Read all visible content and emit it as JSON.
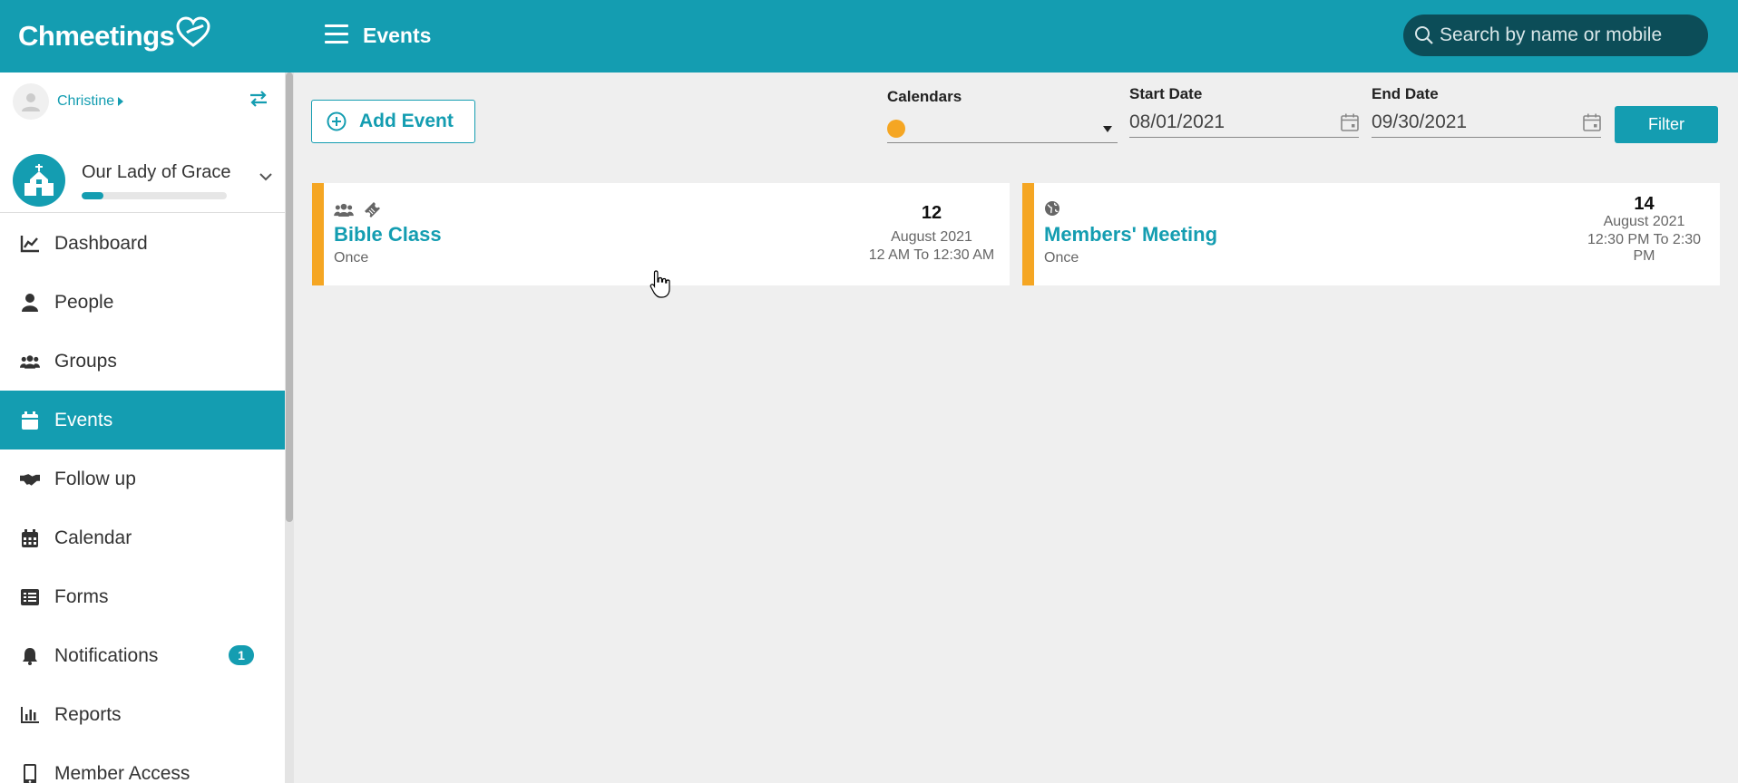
{
  "app": {
    "logo_text": "Chmeetings",
    "page_title": "Events",
    "search_placeholder": "Search by name or mobile",
    "brand_color": "#149db1"
  },
  "sidebar": {
    "user_name": "Christine",
    "org_name": "Our Lady of Grace",
    "org_progress": 0.15,
    "items": [
      {
        "label": "Dashboard",
        "icon": "chart-line-icon",
        "active": false
      },
      {
        "label": "People",
        "icon": "user-icon",
        "active": false
      },
      {
        "label": "Groups",
        "icon": "users-icon",
        "active": false
      },
      {
        "label": "Events",
        "icon": "calendar-icon",
        "active": true
      },
      {
        "label": "Follow up",
        "icon": "handshake-icon",
        "active": false
      },
      {
        "label": "Calendar",
        "icon": "calendar-grid-icon",
        "active": false
      },
      {
        "label": "Forms",
        "icon": "list-icon",
        "active": false
      },
      {
        "label": "Notifications",
        "icon": "bell-icon",
        "active": false,
        "badge": "1"
      },
      {
        "label": "Reports",
        "icon": "bar-chart-icon",
        "active": false
      },
      {
        "label": "Member Access",
        "icon": "mobile-icon",
        "active": false
      }
    ]
  },
  "toolbar": {
    "add_event_label": "Add Event",
    "calendars_label": "Calendars",
    "calendar_color": "#f5a623",
    "start_date_label": "Start Date",
    "start_date_value": "08/01/2021",
    "end_date_label": "End Date",
    "end_date_value": "09/30/2021",
    "filter_label": "Filter"
  },
  "events": [
    {
      "title": "Bible Class",
      "frequency": "Once",
      "day": "12",
      "month": "August 2021",
      "time": "12 AM To 12:30 AM",
      "icons": [
        "users-icon",
        "ticket-icon"
      ],
      "color": "#f5a623"
    },
    {
      "title": "Members' Meeting",
      "frequency": "Once",
      "day": "14",
      "month": "August 2021",
      "time": "12:30 PM To 2:30 PM",
      "icons": [
        "globe-icon"
      ],
      "color": "#f5a623"
    }
  ]
}
